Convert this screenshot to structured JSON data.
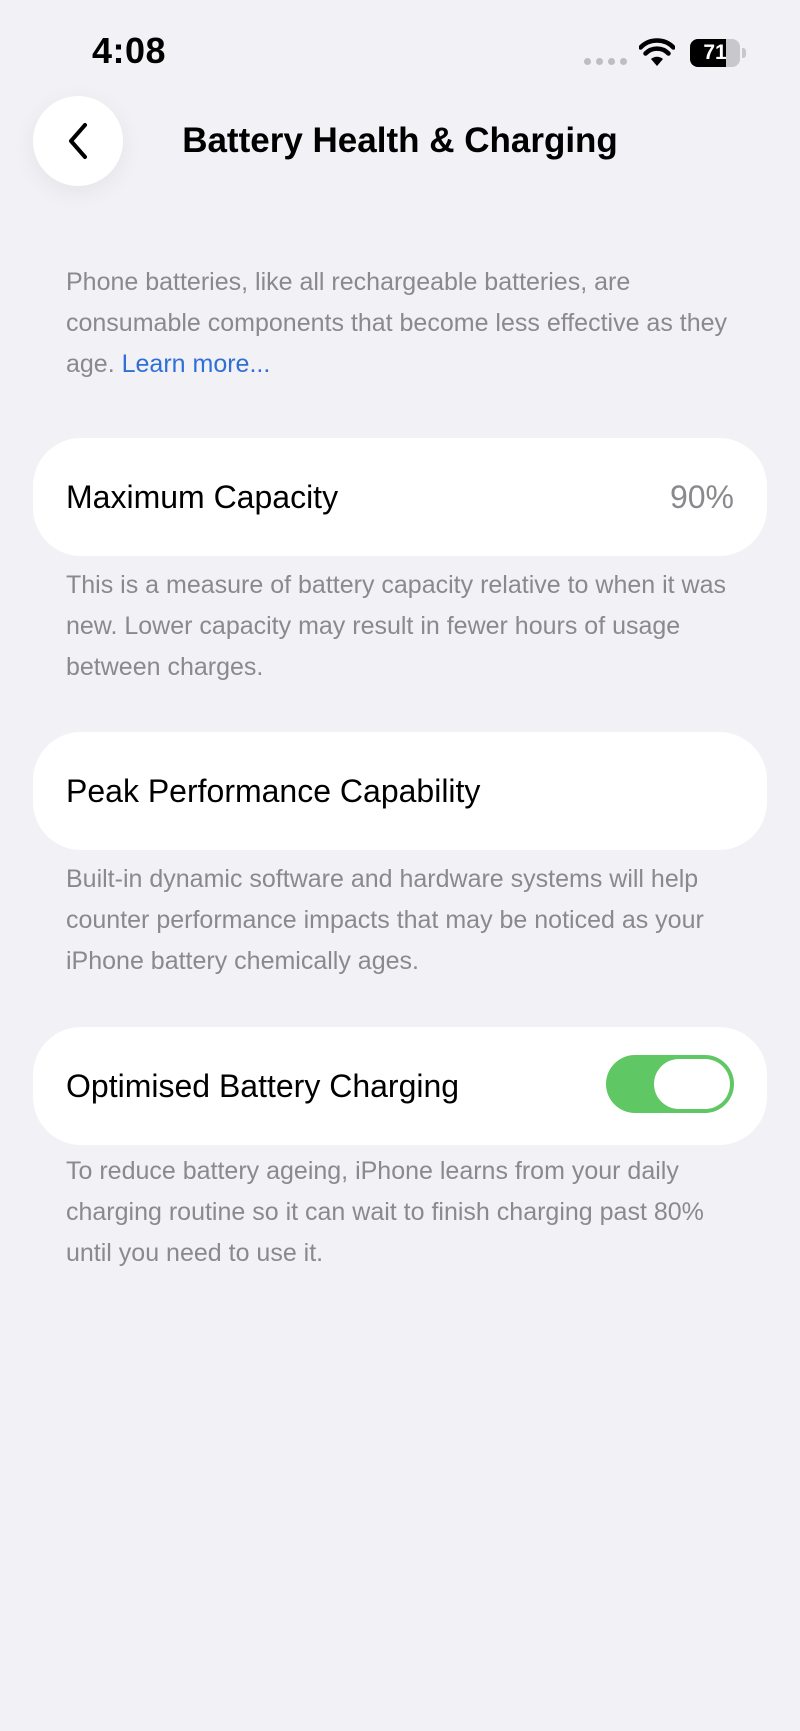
{
  "status_bar": {
    "time": "4:08",
    "battery_level": "71",
    "battery_fraction": 0.71
  },
  "header": {
    "title": "Battery Health & Charging",
    "back_icon": "chevron-left-icon"
  },
  "intro": {
    "text": "Phone batteries, like all rechargeable batteries, are consumable components that become less effective as they age. ",
    "link": "Learn more..."
  },
  "maximum_capacity": {
    "label": "Maximum Capacity",
    "value": "90%",
    "description": "This is a measure of battery capacity relative to when it was new. Lower capacity may result in fewer hours of usage between charges."
  },
  "peak_performance": {
    "label": "Peak Performance Capability",
    "description": "Built-in dynamic software and hardware systems will help counter performance impacts that may be noticed as your iPhone battery chemically ages."
  },
  "optimised_charging": {
    "label": "Optimised Battery Charging",
    "enabled": true,
    "description": "To reduce battery ageing, iPhone learns from your daily charging routine so it can wait to finish charging past 80% until you need to use it."
  },
  "colors": {
    "background": "#f1f1f6",
    "link": "#2f6fd6",
    "toggle_on": "#5fc763",
    "secondary_text": "#8a8a8e"
  }
}
